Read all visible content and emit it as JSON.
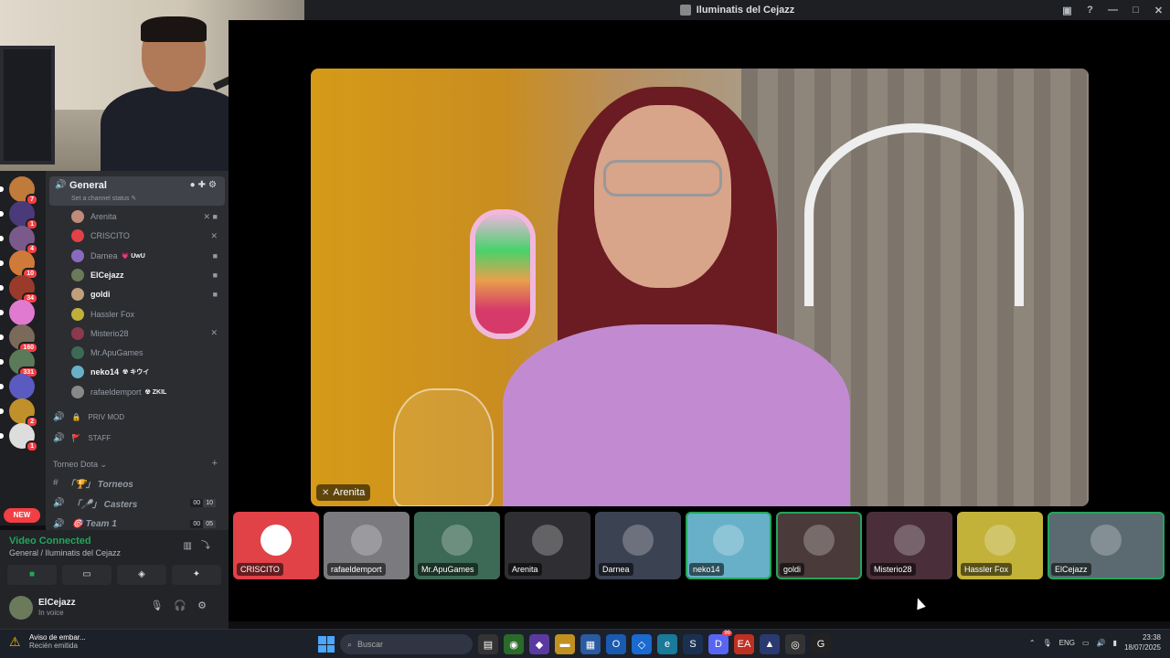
{
  "window": {
    "title": "Iluminatis del Cejazz"
  },
  "main_video": {
    "label": "Arenita"
  },
  "tiles": [
    {
      "name": "CRISCITO",
      "bg": "#e04248",
      "speaking": false,
      "icon": "discord-logo-icon"
    },
    {
      "name": "rafaeldemport",
      "bg": "#7a7a7f",
      "speaking": false
    },
    {
      "name": "Mr.ApuGames",
      "bg": "#3c6a56",
      "speaking": false
    },
    {
      "name": "Arenita",
      "bg": "#2f2f33",
      "speaking": false
    },
    {
      "name": "Darnea",
      "bg": "#3b4252",
      "speaking": false
    },
    {
      "name": "neko14",
      "bg": "#67b0c8",
      "speaking": true
    },
    {
      "name": "goldi",
      "bg": "#4a3a3a",
      "speaking": true
    },
    {
      "name": "Misterio28",
      "bg": "#4a2f3a",
      "speaking": false
    },
    {
      "name": "Hassler Fox",
      "bg": "#c2b23a",
      "speaking": false
    },
    {
      "name": "ElCejazz",
      "bg": "#5a6a70",
      "speaking": true
    }
  ],
  "servers": [
    {
      "badge": "7",
      "color": "#c07a3a"
    },
    {
      "badge": "1",
      "color": "#4a3a7a"
    },
    {
      "badge": "4",
      "color": "#7a5a8a"
    },
    {
      "badge": "10",
      "color": "#d07a3a"
    },
    {
      "badge": "34",
      "color": "#9a3a2a"
    },
    {
      "badge": "",
      "color": "#e07ad0"
    },
    {
      "badge": "160",
      "color": "#7a6a5a"
    },
    {
      "badge": "331",
      "color": "#5a7a5a"
    },
    {
      "badge": "",
      "color": "#5a5ac0"
    },
    {
      "badge": "2",
      "color": "#c0902a"
    },
    {
      "badge": "1",
      "color": "#ddd"
    }
  ],
  "new_badge": "NEW",
  "channel": {
    "name": "General",
    "status": "Set a channel status ✎",
    "members": [
      {
        "name": "Arenita",
        "active": false,
        "tag": "",
        "icons": "✕ ■",
        "color": "#c08a7a"
      },
      {
        "name": "CRISCITO",
        "active": false,
        "tag": "",
        "icons": "✕",
        "color": "#e04248"
      },
      {
        "name": "Darnea",
        "active": false,
        "tag": "💗 UwU",
        "icons": "■",
        "color": "#8a6ac0"
      },
      {
        "name": "ElCejazz",
        "active": true,
        "tag": "",
        "icons": "■",
        "color": "#6a7a5a"
      },
      {
        "name": "goldi",
        "active": true,
        "tag": "",
        "icons": "■",
        "color": "#c0a07a"
      },
      {
        "name": "Hassler Fox",
        "active": false,
        "tag": "",
        "icons": "",
        "color": "#c0b03a"
      },
      {
        "name": "Misterio28",
        "active": false,
        "tag": "",
        "icons": "✕",
        "color": "#8a3a4a"
      },
      {
        "name": "Mr.ApuGames",
        "active": false,
        "tag": "",
        "icons": "",
        "color": "#3c6a56"
      },
      {
        "name": "neko14",
        "active": true,
        "tag": "☢ キウイ",
        "icons": "",
        "color": "#67b0c8"
      },
      {
        "name": "rafaeldemport",
        "active": false,
        "tag": "☢ ZKIL",
        "icons": "",
        "color": "#888"
      }
    ],
    "voice_channels": [
      {
        "name": "PRIV MOD",
        "lock": "🔒"
      },
      {
        "name": "STAFF",
        "lock": "🚩"
      }
    ],
    "category": "Torneo Dota ⌄",
    "tournament_channels": [
      {
        "name": "「🏆」 Torneos",
        "hash": "#",
        "c1": "",
        "c2": ""
      },
      {
        "name": "「🎤」 Casters",
        "hash": "🔊",
        "c1": "00",
        "c2": "10"
      },
      {
        "name": "🎯 Team 1",
        "hash": "🔊",
        "c1": "00",
        "c2": "05"
      }
    ]
  },
  "voice_panel": {
    "title": "Video Connected",
    "location": "General / Iluminatis del Cejazz"
  },
  "user": {
    "name": "ElCejazz",
    "status": "In voice"
  },
  "taskbar": {
    "notif_title": "Aviso de embar...",
    "notif_sub": "Recién emitida",
    "search_placeholder": "Buscar",
    "lang": "ENG",
    "time": "23:38",
    "date": "18/07/2025",
    "discord_badge": "99"
  }
}
